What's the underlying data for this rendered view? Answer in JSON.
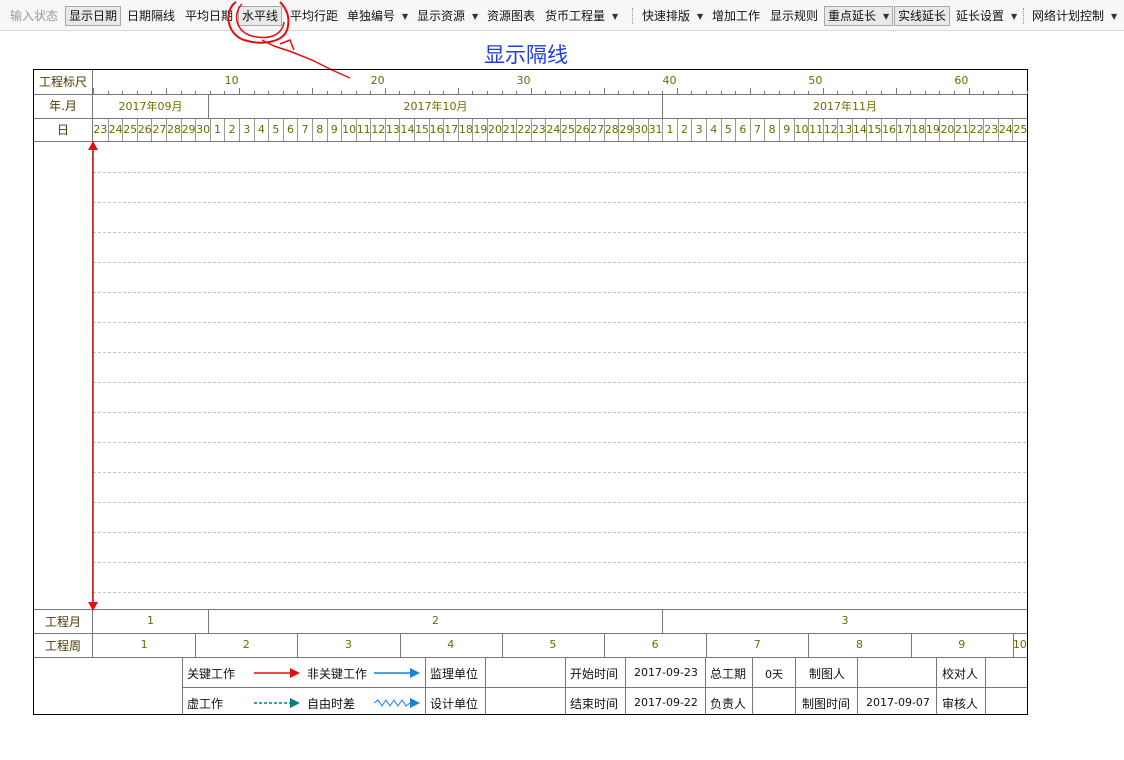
{
  "toolbar": {
    "items": [
      {
        "label": "输入状态",
        "state": "disabled"
      },
      {
        "label": "显示日期",
        "state": "pressed"
      },
      {
        "label": "日期隔线",
        "state": "normal"
      },
      {
        "label": "平均日期",
        "state": "normal"
      },
      {
        "label": "水平线",
        "state": "pressed"
      },
      {
        "label": "平均行距",
        "state": "normal"
      },
      {
        "label": "单独编号",
        "state": "dropdown"
      },
      {
        "label": "显示资源",
        "state": "dropdown"
      },
      {
        "label": "资源图表",
        "state": "normal"
      },
      {
        "label": "货币工程量",
        "state": "dropdown"
      },
      {
        "label": "快速排版",
        "state": "dropdown"
      },
      {
        "label": "增加工作",
        "state": "normal"
      },
      {
        "label": "显示规则",
        "state": "normal"
      },
      {
        "label": "重点延长",
        "state": "pressed-dropdown"
      },
      {
        "label": "实线延长",
        "state": "pressed"
      },
      {
        "label": "延长设置",
        "state": "dropdown"
      },
      {
        "label": "网络计划控制",
        "state": "dropdown"
      }
    ],
    "dropdown_icon": "dropdown-arrow-icon"
  },
  "annotation": {
    "title": "显示隔线",
    "color": "#1f3de0",
    "sketch_color": "#e01010",
    "sketch_icon": "hand-drawn-circle-arrow-icon"
  },
  "header": {
    "ruler_label": "工程标尺",
    "ruler_ticks": [
      "10",
      "20",
      "30",
      "40",
      "50",
      "60"
    ],
    "month_label": "年.月",
    "months": [
      "2017年09月",
      "2017年10月",
      "2017年11月"
    ],
    "day_label": "日",
    "days": [
      "23",
      "24",
      "25",
      "26",
      "27",
      "28",
      "29",
      "30",
      "1",
      "2",
      "3",
      "4",
      "5",
      "6",
      "7",
      "8",
      "9",
      "10",
      "11",
      "12",
      "13",
      "14",
      "15",
      "16",
      "17",
      "18",
      "19",
      "20",
      "21",
      "22",
      "23",
      "24",
      "25",
      "26",
      "27",
      "28",
      "29",
      "30",
      "31",
      "1",
      "2",
      "3",
      "4",
      "5",
      "6",
      "7",
      "8",
      "9",
      "10",
      "11",
      "12",
      "13",
      "14",
      "15",
      "16",
      "17",
      "18",
      "19",
      "20",
      "21",
      "22",
      "23",
      "24",
      "25"
    ]
  },
  "footer": {
    "project_month_label": "工程月",
    "project_months": [
      "1",
      "2",
      "3"
    ],
    "project_week_label": "工程周",
    "project_weeks": [
      "1",
      "2",
      "3",
      "4",
      "5",
      "6",
      "7",
      "8",
      "9",
      "10"
    ]
  },
  "legend": {
    "critical": "关键工作",
    "noncritical": "非关键工作",
    "virtual": "虚工作",
    "free_float": "自由时差",
    "critical_color": "#e01010",
    "noncritical_color": "#1a7fe0",
    "virtual_color": "#008080",
    "supervisor_label": "监理单位",
    "supervisor_value": "",
    "design_label": "设计单位",
    "design_value": "",
    "start_label": "开始时间",
    "start_value": "2017-09-23",
    "end_label": "结束时间",
    "end_value": "2017-09-22",
    "duration_label": "总工期",
    "duration_value": "0天",
    "owner_label": "负责人",
    "owner_value": "",
    "drafter_label": "制图人",
    "drafter_value": "",
    "draw_time_label": "制图时间",
    "draw_time_value": "2017-09-07",
    "proof_label": "校对人",
    "proof_value": "",
    "review_label": "审核人",
    "review_value": ""
  }
}
